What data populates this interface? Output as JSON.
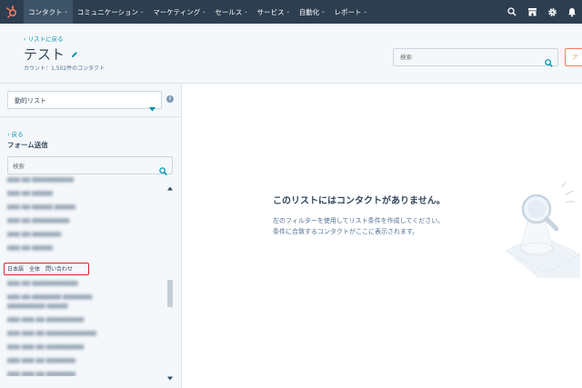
{
  "nav": {
    "items": [
      {
        "label": "コンタクト"
      },
      {
        "label": "コミュニケーション"
      },
      {
        "label": "マーケティング"
      },
      {
        "label": "セールス"
      },
      {
        "label": "サービス"
      },
      {
        "label": "自動化"
      },
      {
        "label": "レポート"
      }
    ],
    "caret": "⌄",
    "icons": [
      "search-icon",
      "marketplace-icon",
      "gear-icon",
      "bell-icon"
    ]
  },
  "header": {
    "back_label": "‹ リストに戻る",
    "title": "テスト",
    "count": "カウント：1,502件のコンタクト",
    "search_placeholder": "検索",
    "action_label": "ア"
  },
  "sidebar": {
    "select_value": "動的リスト",
    "info": "i",
    "back_label": "‹ 戻る",
    "heading": "フォーム送信",
    "search_placeholder": "検索",
    "forms": [
      {
        "label": "日本語　全体　問い合わせ"
      }
    ]
  },
  "main": {
    "empty_title": "このリストにはコンタクトがありません。",
    "empty_line1": "左のフィルターを使用してリスト条件を作成してください。",
    "empty_line2": "条件に合致するコンタクトがここに表示されます。"
  },
  "colors": {
    "nav_bg": "#2d3e50",
    "accent": "#0091ae",
    "brand_orange": "#ff7a59",
    "highlight": "#e0242e"
  }
}
